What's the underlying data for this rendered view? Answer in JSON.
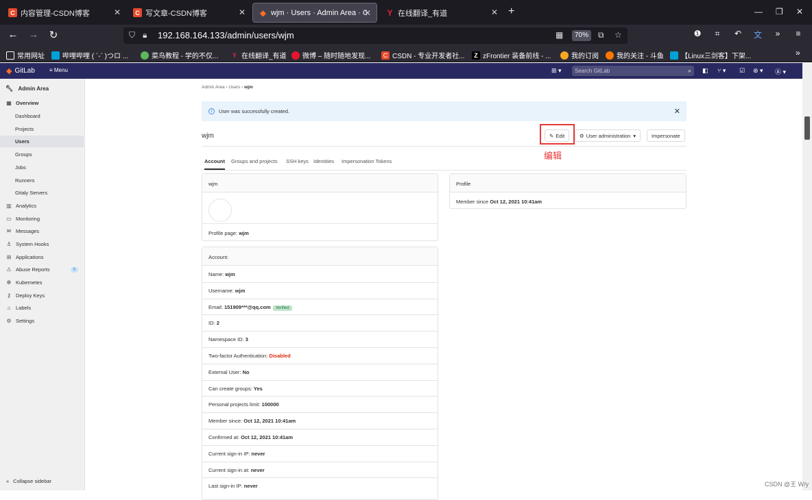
{
  "browser": {
    "tabs": [
      {
        "title": "内容管理-CSDN博客",
        "icon": "csdn-icon",
        "favtext": "C"
      },
      {
        "title": "写文章-CSDN博客",
        "icon": "csdn-icon",
        "favtext": "C"
      },
      {
        "title": "wjm · Users · Admin Area · Gi",
        "icon": "gitlab-icon",
        "favtext": "◆"
      },
      {
        "title": "在线翻译_有道",
        "icon": "youdao-icon",
        "favtext": "Y"
      }
    ],
    "url": "192.168.164.133/admin/users/wjm",
    "zoom": "70%",
    "bookmarks": [
      {
        "label": "常用网址",
        "icon": "folder-icon"
      },
      {
        "label": "哔哩哔哩 ( ´-` )つロ ...",
        "icon": "bilibili-icon"
      },
      {
        "label": "菜鸟教程 - 学的不仅...",
        "icon": "runoob-icon"
      },
      {
        "label": "在线翻译_有道",
        "icon": "youdao-icon"
      },
      {
        "label": "微博 – 随时随地发现...",
        "icon": "weibo-icon"
      },
      {
        "label": "CSDN - 专业开发者社...",
        "icon": "csdn-icon"
      },
      {
        "label": "zFrontier 装备前线 - ...",
        "icon": "zfrontier-icon"
      },
      {
        "label": "我的订阅",
        "icon": "subscription-icon"
      },
      {
        "label": "我的关注 - 斗鱼",
        "icon": "douyu-icon"
      },
      {
        "label": "【Linux三剑客】下架...",
        "icon": "bilibili-icon"
      }
    ]
  },
  "gitlab": {
    "brand": "GitLab",
    "menu": "Menu",
    "search_placeholder": "Search GitLab"
  },
  "sidebar": {
    "title": "Admin Area",
    "overview": "Overview",
    "overview_items": [
      "Dashboard",
      "Projects",
      "Users",
      "Groups",
      "Jobs",
      "Runners",
      "Gitaly Servers"
    ],
    "active": "Users",
    "items": [
      {
        "label": "Analytics",
        "icon": "chart-icon"
      },
      {
        "label": "Monitoring",
        "icon": "monitor-icon"
      },
      {
        "label": "Messages",
        "icon": "messages-icon"
      },
      {
        "label": "System Hooks",
        "icon": "hook-icon"
      },
      {
        "label": "Applications",
        "icon": "applications-icon"
      },
      {
        "label": "Abuse Reports",
        "icon": "abuse-icon",
        "badge": "0"
      },
      {
        "label": "Kubernetes",
        "icon": "kubernetes-icon"
      },
      {
        "label": "Deploy Keys",
        "icon": "key-icon"
      },
      {
        "label": "Labels",
        "icon": "label-icon"
      },
      {
        "label": "Settings",
        "icon": "settings-icon"
      }
    ],
    "collapse": "Collapse sidebar"
  },
  "breadcrumb": {
    "a": "Admin Area",
    "b": "Users",
    "c": "wjm"
  },
  "alert": "User was successfully created.",
  "user": {
    "name": "wjm",
    "edit": "Edit",
    "user_admin": "User administration",
    "impersonate": "Impersonate",
    "annotation": "编辑"
  },
  "tabs": [
    "Account",
    "Groups and projects",
    "SSH keys",
    "Identities",
    "Impersonation Tokens"
  ],
  "profile_card": {
    "header": "wjm",
    "profile_page_label": "Profile page:",
    "profile_page_value": "wjm"
  },
  "profile_right": {
    "header": "Profile",
    "member_since_label": "Member since",
    "member_since_value": "Oct 12, 2021 10:41am"
  },
  "account": {
    "header": "Account:",
    "rows": [
      {
        "label": "Name:",
        "value": "wjm"
      },
      {
        "label": "Username:",
        "value": "wjm"
      },
      {
        "label": "Email:",
        "value": "151909***@qq.com",
        "badge": "Verified"
      },
      {
        "label": "ID:",
        "value": "2"
      },
      {
        "label": "Namespace ID:",
        "value": "3"
      },
      {
        "label": "Two-factor Authentication:",
        "value": "Disabled",
        "red": true
      },
      {
        "label": "External User:",
        "value": "No"
      },
      {
        "label": "Can create groups:",
        "value": "Yes"
      },
      {
        "label": "Personal projects limit:",
        "value": "100000"
      },
      {
        "label": "Member since:",
        "value": "Oct 12, 2021 10:41am"
      },
      {
        "label": "Confirmed at:",
        "value": "Oct 12, 2021 10:41am"
      },
      {
        "label": "Current sign-in IP:",
        "value": "never"
      },
      {
        "label": "Current sign-in at:",
        "value": "never"
      },
      {
        "label": "Last sign-in IP:",
        "value": "never"
      }
    ]
  },
  "watermark": "CSDN @王 W/y"
}
